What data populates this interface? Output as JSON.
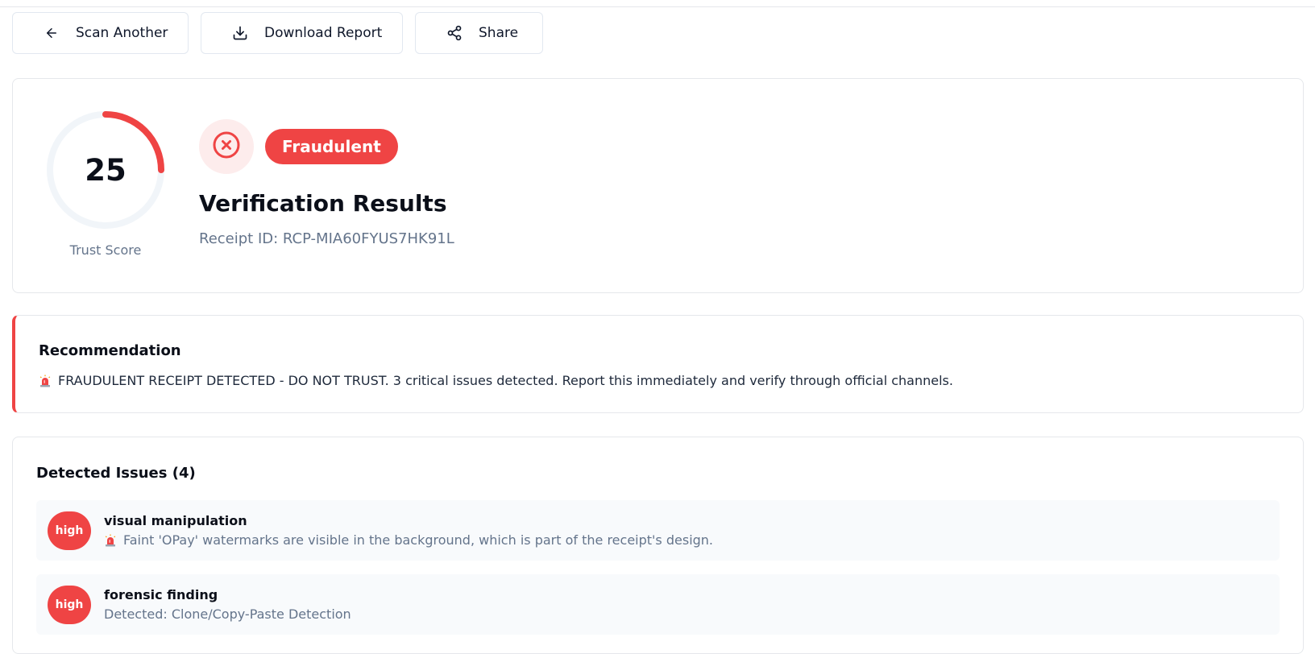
{
  "toolbar": {
    "scan_label": "Scan Another",
    "download_label": "Download Report",
    "share_label": "Share"
  },
  "summary": {
    "trust_score": "25",
    "trust_score_fraction": 0.25,
    "trust_score_label": "Trust Score",
    "status_label": "Fraudulent",
    "title": "Verification Results",
    "receipt_id": "Receipt ID: RCP-MIA60FYUS7HK91L"
  },
  "recommendation": {
    "title": "Recommendation",
    "text": "FRAUDULENT RECEIPT DETECTED - DO NOT TRUST. 3 critical issues detected. Report this immediately and verify through official channels."
  },
  "issues": {
    "title": "Detected Issues (4)",
    "items": [
      {
        "severity": "high",
        "title": "visual manipulation",
        "description": "Faint 'OPay' watermarks are visible in the background, which is part of the receipt's design.",
        "icon": "siren-icon"
      },
      {
        "severity": "high",
        "title": "forensic finding",
        "description": "Detected: Clone/Copy-Paste Detection"
      }
    ]
  },
  "colors": {
    "danger": "#ef4444",
    "danger_bg": "#fdecec",
    "muted_text": "#64748b",
    "ring_track": "#f1f5f9"
  }
}
